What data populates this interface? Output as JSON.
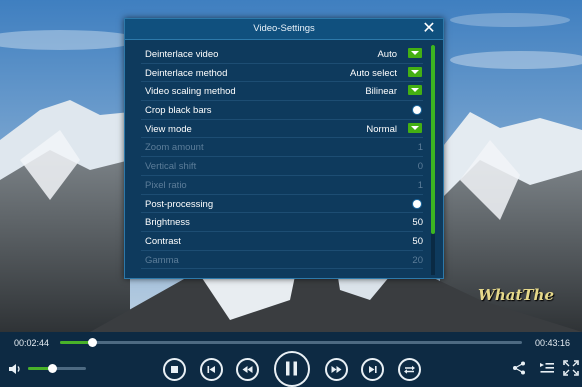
{
  "video": {
    "watermark": "WhatThe"
  },
  "dialog": {
    "title": "Video-Settings",
    "close_glyph": "✕",
    "rows": [
      {
        "label": "Deinterlace video",
        "value": "Auto",
        "control": "dropdown",
        "enabled": true
      },
      {
        "label": "Deinterlace method",
        "value": "Auto select",
        "control": "dropdown",
        "enabled": true
      },
      {
        "label": "Video scaling method",
        "value": "Bilinear",
        "control": "dropdown",
        "enabled": true
      },
      {
        "label": "Crop black bars",
        "value": "",
        "control": "toggle",
        "enabled": true
      },
      {
        "label": "View mode",
        "value": "Normal",
        "control": "dropdown",
        "enabled": true
      },
      {
        "label": "Zoom amount",
        "value": "1",
        "control": "value",
        "enabled": false
      },
      {
        "label": "Vertical shift",
        "value": "0",
        "control": "value",
        "enabled": false
      },
      {
        "label": "Pixel ratio",
        "value": "1",
        "control": "value",
        "enabled": false
      },
      {
        "label": "Post-processing",
        "value": "",
        "control": "toggle",
        "enabled": true
      },
      {
        "label": "Brightness",
        "value": "50",
        "control": "value",
        "enabled": true
      },
      {
        "label": "Contrast",
        "value": "50",
        "control": "value",
        "enabled": true
      },
      {
        "label": "Gamma",
        "value": "20",
        "control": "value",
        "enabled": false
      }
    ],
    "scroll_fraction": 0.82
  },
  "player": {
    "current_time": "00:02:44",
    "total_time": "00:43:16",
    "progress": 0.069,
    "volume": 0.42
  },
  "colors": {
    "accent": "#49b229",
    "panel": "#0e3a5d",
    "bar": "#0d2a43"
  },
  "icons": {
    "volume": "volume-icon",
    "stop": "stop-icon",
    "skip_previous": "skip-previous-icon",
    "rewind": "rewind-icon",
    "pause": "pause-icon",
    "fast_forward": "fast-forward-icon",
    "skip_next": "skip-next-icon",
    "repeat": "repeat-icon",
    "share": "share-icon",
    "playlist": "playlist-icon",
    "fullscreen": "fullscreen-icon"
  }
}
